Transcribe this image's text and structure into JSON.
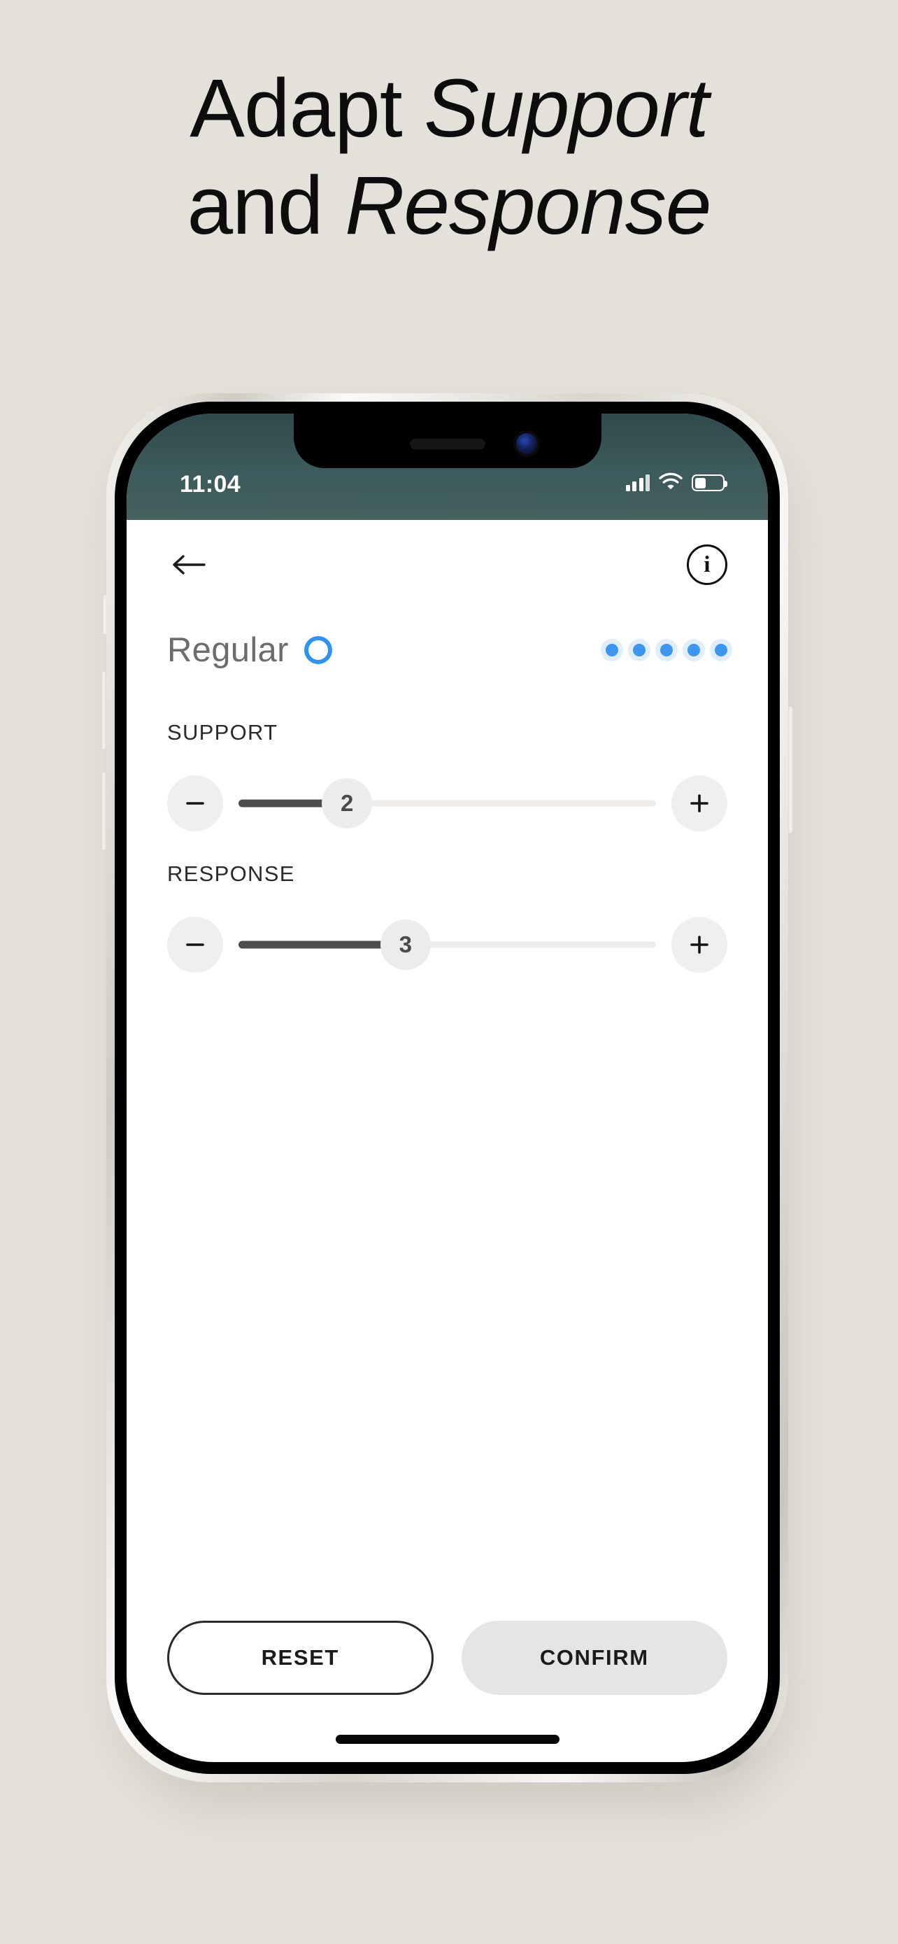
{
  "page": {
    "background_color": "#e4e1da",
    "headline": {
      "line1_regular": "Adapt ",
      "line1_italic": "Support",
      "line2_regular": "and ",
      "line2_italic": "Response"
    }
  },
  "phone": {
    "status_bar": {
      "time": "11:04",
      "signal_icon": "cellular-bars-icon",
      "wifi_icon": "wifi-icon",
      "battery_icon": "battery-icon",
      "background_color": "#3d5a5c"
    },
    "home_indicator": "home-indicator"
  },
  "app": {
    "topbar": {
      "back_icon": "back-arrow-icon",
      "info_icon": "info-icon",
      "info_glyph": "i"
    },
    "mode": {
      "label": "Regular",
      "ring_icon": "mode-ring-icon",
      "ring_color": "#2f93f0",
      "dots_count": 5,
      "dot_color": "#3d96ef"
    },
    "sliders": [
      {
        "label": "SUPPORT",
        "value": "2",
        "min": 0,
        "max": 8,
        "fill_percent": 26,
        "decrement_icon": "minus-icon",
        "increment_icon": "plus-icon",
        "fill_color": "#4d4d4d",
        "track_color": "#eeedeb"
      },
      {
        "label": "RESPONSE",
        "value": "3",
        "min": 0,
        "max": 8,
        "fill_percent": 40,
        "decrement_icon": "minus-icon",
        "increment_icon": "plus-icon",
        "fill_color": "#4d4d4d",
        "track_color": "#eeedeb"
      }
    ],
    "footer": {
      "reset_label": "RESET",
      "confirm_label": "CONFIRM"
    }
  }
}
